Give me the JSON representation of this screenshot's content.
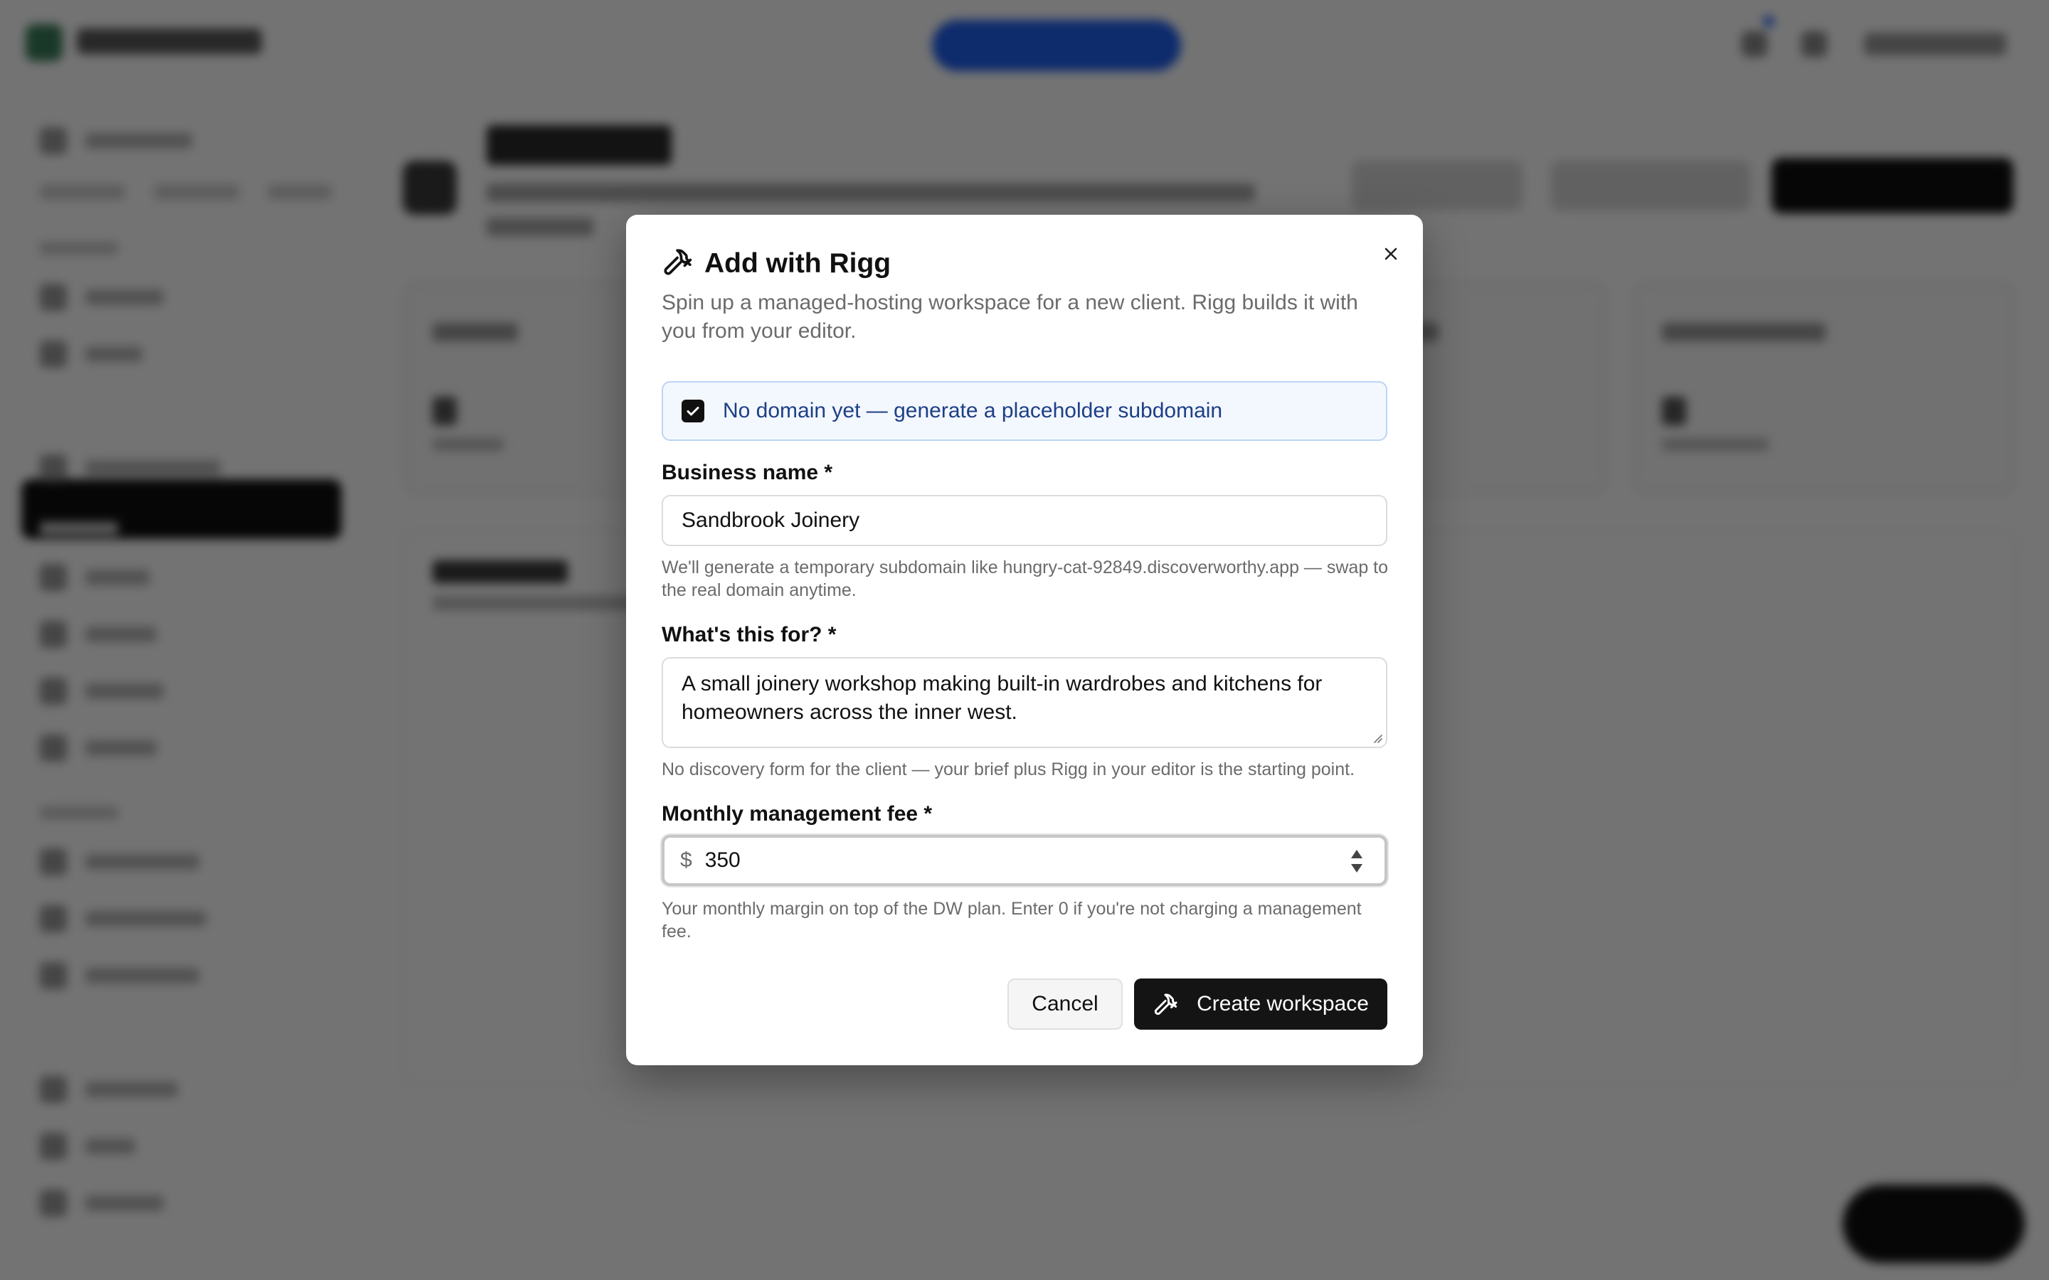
{
  "modal": {
    "title": "Add with Rigg",
    "title_icon": "hammer-icon",
    "close_icon": "close-icon",
    "description": "Spin up a managed-hosting workspace for a new client. Rigg builds it with you from your editor.",
    "placeholder_checkbox": {
      "checked": true,
      "label": "No domain yet — generate a placeholder subdomain"
    },
    "business_name": {
      "label": "Business name *",
      "value": "Sandbrook Joinery",
      "hint": "We'll generate a temporary subdomain like hungry-cat-92849.discoverworthy.app — swap to the real domain anytime."
    },
    "purpose": {
      "label": "What's this for? *",
      "value": "A small joinery workshop making built-in wardrobes and kitchens for homeowners across the inner west.",
      "hint": "No discovery form for the client — your brief plus Rigg in your editor is the starting point."
    },
    "fee": {
      "label": "Monthly management fee *",
      "prefix": "$",
      "value": "350",
      "hint": "Your monthly margin on top of the DW plan. Enter 0 if you're not charging a management fee."
    },
    "cancel_label": "Cancel",
    "create_label": "Create workspace"
  },
  "colors": {
    "overlay": "#000000",
    "primary_button": "#141414",
    "checkbox_highlight_bg": "#f3f7fe",
    "checkbox_label": "#1d3f86"
  }
}
